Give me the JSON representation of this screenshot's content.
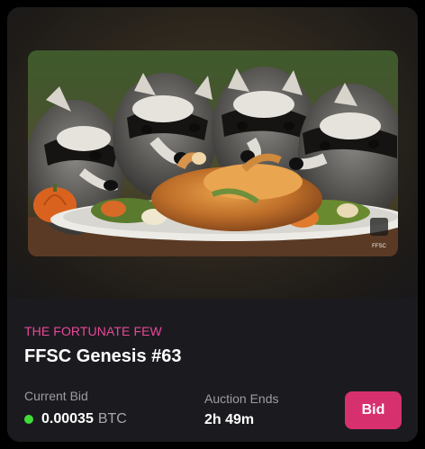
{
  "card": {
    "collection": "THE FORTUNATE FEW",
    "title": "FFSC Genesis #63",
    "current_bid_label": "Current Bid",
    "bid_amount": "0.00035",
    "bid_currency": "BTC",
    "auction_label": "Auction Ends",
    "auction_time": "2h 49m",
    "bid_button_label": "Bid",
    "status_icon": "green-dot-icon",
    "image_watermark": "FFSC"
  },
  "colors": {
    "accent": "#e8489a",
    "button": "#d6306f",
    "status": "#3fdc3a",
    "card_bg": "#1b1b1f"
  }
}
